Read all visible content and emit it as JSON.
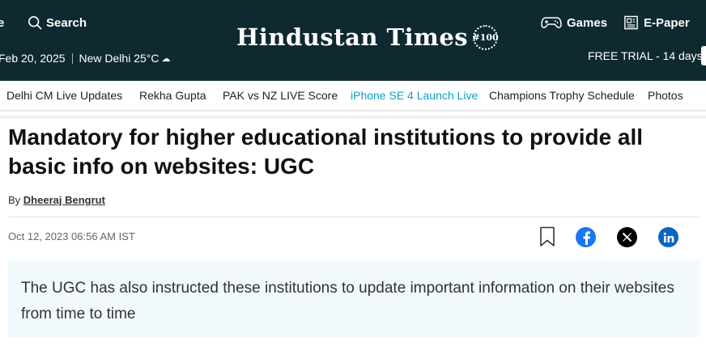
{
  "header": {
    "menu_fragment": "e",
    "search_label": "Search",
    "date": "Feb 20, 2025",
    "weather": "New Delhi 25°C",
    "logo_text": "Hindustan Times",
    "logo_seal": "#100",
    "games_label": "Games",
    "epaper_label": "E-Paper",
    "free_trial": "FREE TRIAL - 14 days"
  },
  "nav": {
    "items": [
      {
        "label": "Delhi CM Live Updates"
      },
      {
        "label": "Rekha Gupta"
      },
      {
        "label": "PAK vs NZ LIVE Score"
      },
      {
        "label": "iPhone SE 4 Launch Live"
      },
      {
        "label": "Champions Trophy Schedule"
      },
      {
        "label": "Photos"
      }
    ],
    "highlight_color": "#0f9fc9"
  },
  "article": {
    "headline": "Mandatory for higher educational institutions to provide all basic info on websites: UGC",
    "by_prefix": "By",
    "author": "Dheeraj Bengrut",
    "timestamp": "Oct 12, 2023 06:56 AM IST",
    "summary": "The UGC has also instructed these institutions to update important information on their websites from time to time"
  },
  "share": {
    "icons": [
      "bookmark-icon",
      "facebook-icon",
      "x-icon",
      "linkedin-icon"
    ]
  },
  "colors": {
    "header_bg": "#0e2a30",
    "summary_bg": "#f1f9fc"
  }
}
